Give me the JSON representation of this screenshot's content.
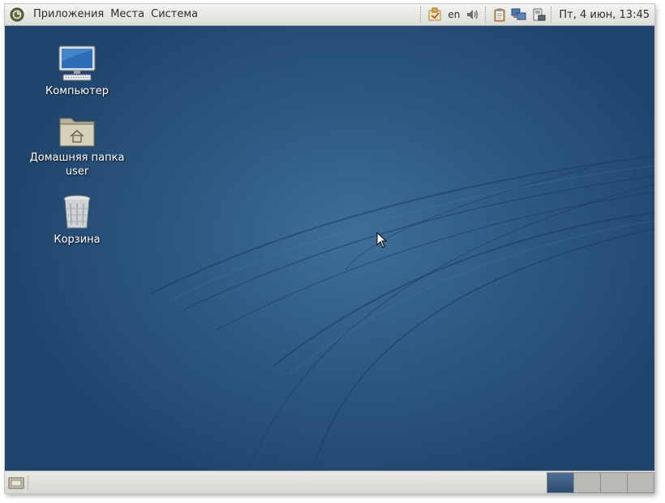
{
  "top_panel": {
    "menus": [
      "Приложения",
      "Места",
      "Система"
    ],
    "language": "en",
    "clock": "Пт,  4 июн, 13:45"
  },
  "desktop": {
    "icons": [
      {
        "label": "Компьютер",
        "icon": "computer-icon"
      },
      {
        "label": "Домашняя папка\nuser",
        "label_line1": "Домашняя папка",
        "label_line2": "user",
        "icon": "home-folder-icon"
      },
      {
        "label": "Корзина",
        "icon": "trash-icon"
      }
    ]
  },
  "bottom_panel": {
    "workspaces": 4,
    "active_workspace": 1
  },
  "colors": {
    "panel": "#dcdcd8",
    "desktop_dark": "#21466e",
    "desktop_light": "#3f6f99",
    "workspace_active": "#2c4d70"
  }
}
